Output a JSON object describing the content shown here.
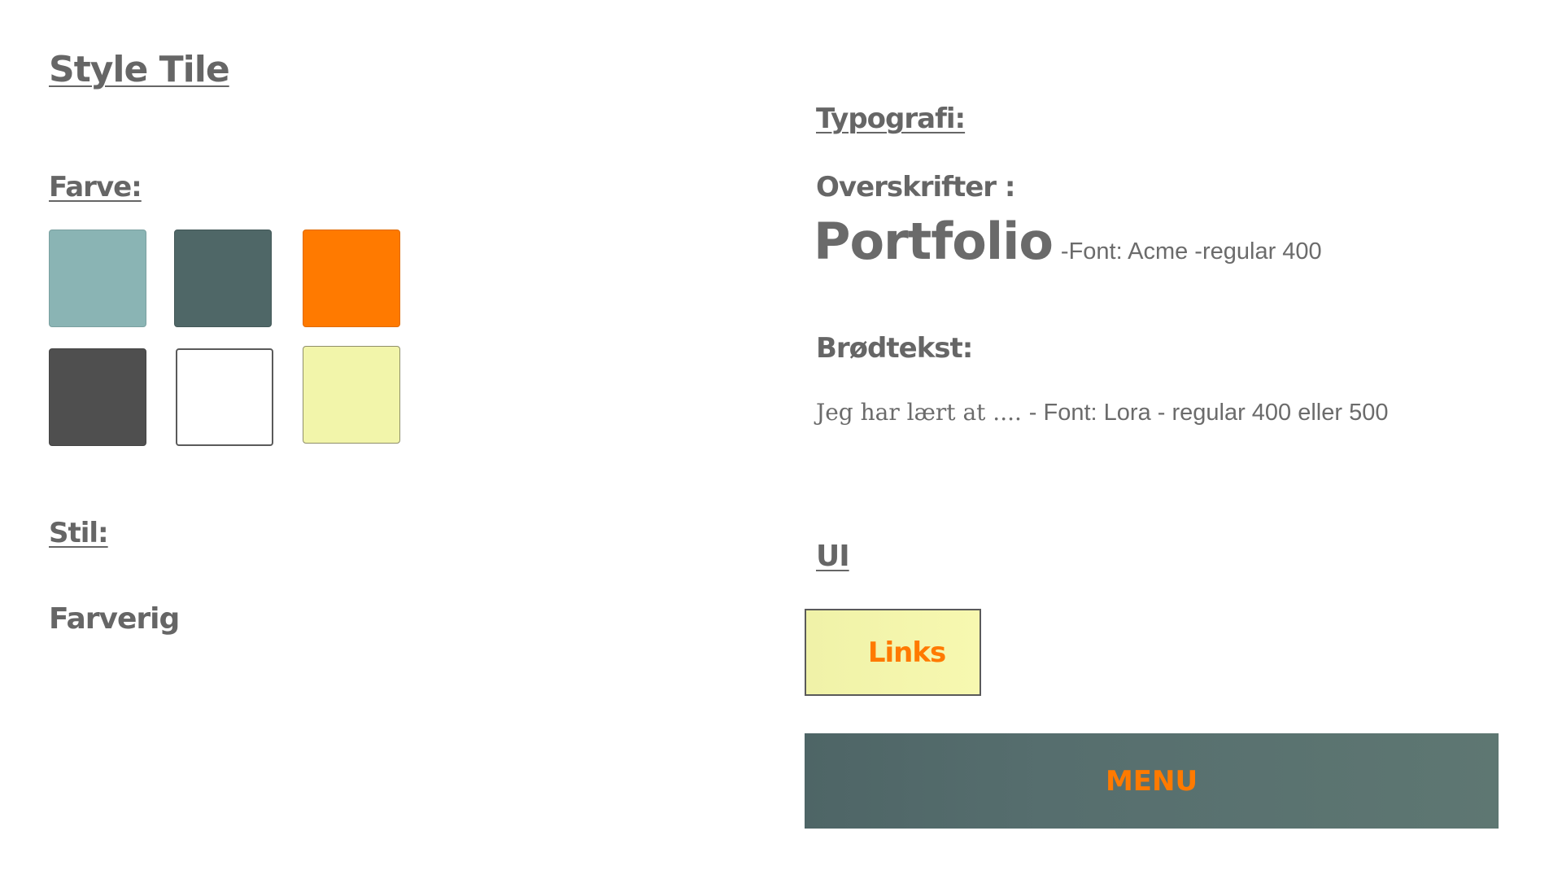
{
  "left": {
    "title": "Style Tile",
    "color_heading": "Farve:",
    "style_heading": "Stil:",
    "style_value": "Farverig",
    "swatches": [
      "#8ab4b4",
      "#4f6767",
      "#ff7a00",
      "#4f4f4f",
      "#ffffff",
      "#f2f5aa"
    ]
  },
  "right": {
    "typography_heading": "Typografi:",
    "headings_label": "Overskrifter :",
    "portfolio_sample": "Portfolio",
    "heading_font_note": "-Font: Acme -regular 400",
    "body_label": "Brødtekst:",
    "body_sample": "Jeg har lært at .... ",
    "body_font_note": "- Font: Lora - regular 400 eller 500",
    "ui_heading": "UI",
    "links_label": "Links",
    "menu_label": "MENU"
  },
  "colors": {
    "text_gray": "#666666",
    "accent_orange": "#ff7a00",
    "menu_bg": "#566e6e",
    "links_bg": "#f2f5aa"
  }
}
